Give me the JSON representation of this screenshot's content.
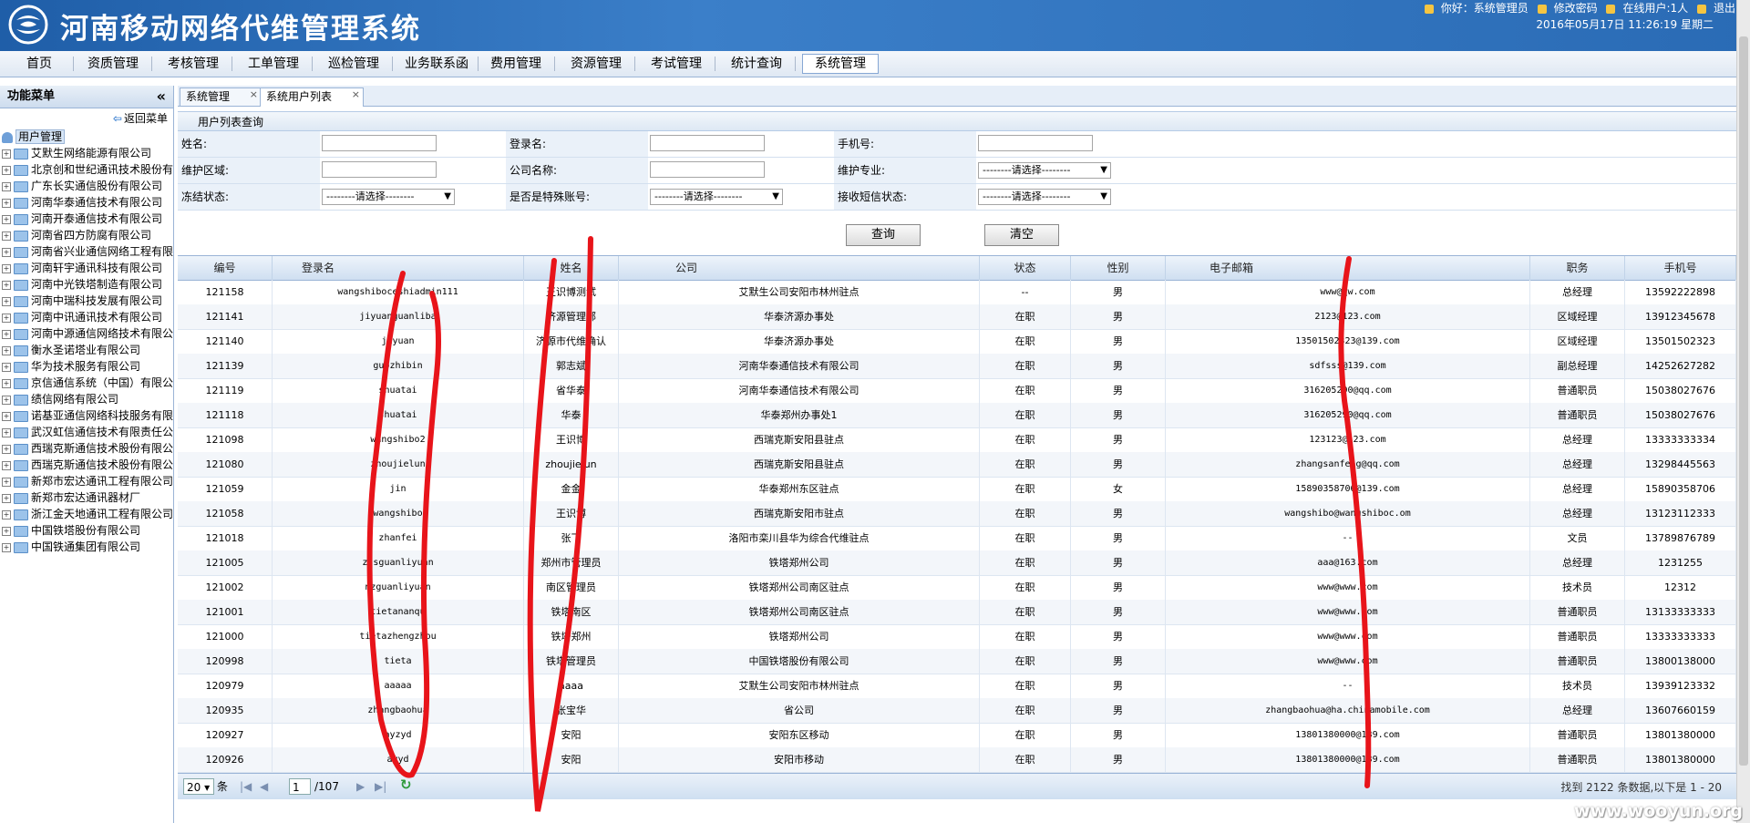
{
  "header": {
    "app_title": "河南移动网络代维管理系统",
    "user_text": "你好：系统管理员",
    "change_pwd": "修改密码",
    "online_users": "在线用户:1人",
    "logout": "退出",
    "datetime": "2016年05月17日  11:26:19 星期二"
  },
  "nav": {
    "items": [
      {
        "label": "首页"
      },
      {
        "label": "资质管理"
      },
      {
        "label": "考核管理"
      },
      {
        "label": "工单管理"
      },
      {
        "label": "巡检管理"
      },
      {
        "label": "业务联系函"
      },
      {
        "label": "费用管理"
      },
      {
        "label": "资源管理"
      },
      {
        "label": "考试管理"
      },
      {
        "label": "统计查询"
      },
      {
        "label": "系统管理"
      }
    ],
    "active_index": 10
  },
  "sidebar": {
    "title": "功能菜单",
    "collapse": "«",
    "back_label": "返回菜单",
    "root_label": "用户管理",
    "nodes": [
      "艾默生网络能源有限公司",
      "北京创和世纪通讯技术股份有限公司",
      "广东长实通信股份有限公司",
      "河南华泰通信技术有限公司",
      "河南开泰通信技术有限公司",
      "河南省四方防腐有限公司",
      "河南省兴业通信网络工程有限公司",
      "河南轩宇通讯科技有限公司",
      "河南中光铁塔制造有限公司",
      "河南中瑞科技发展有限公司",
      "河南中讯通讯技术有限公司",
      "河南中源通信网络技术有限公司",
      "衡水圣诺塔业有限公司",
      "华为技术服务有限公司",
      "京信通信系统（中国）有限公司",
      "绩信网络有限公司",
      "诺基亚通信网络科技服务有限公司",
      "武汉虹信通信技术有限责任公司",
      "西瑞克斯通信技术股份有限公司",
      "西瑞克斯通信技术股份有限公司",
      "新郑市宏达通讯工程有限公司",
      "新郑市宏达通讯器材厂",
      "浙江金天地通讯工程有限公司",
      "中国铁塔股份有限公司",
      "中国铁通集团有限公司"
    ]
  },
  "tabs": [
    {
      "label": "系统管理",
      "close": "×"
    },
    {
      "label": "系统用户列表",
      "close": "×"
    }
  ],
  "panel_title": "用户列表查询",
  "form": {
    "name_label": "姓名:",
    "login_label": "登录名:",
    "phone_label": "手机号:",
    "area_label": "维护区域:",
    "company_label": "公司名称:",
    "specialty_label": "维护专业:",
    "freeze_label": "冻结状态:",
    "special_label": "是否是特殊账号:",
    "sms_label": "接收短信状态:",
    "select_placeholder": "--------请选择--------",
    "query_button": "查询",
    "clear_button": "清空"
  },
  "table": {
    "columns": [
      "编号",
      "登录名",
      "姓名",
      "公司",
      "状态",
      "性别",
      "电子邮箱",
      "职务",
      "手机号"
    ],
    "rows": [
      [
        "121158",
        "wangshiboceshiadmin111",
        "王识博测试",
        "艾默生公司安阳市林州驻点",
        "--",
        "男",
        "www@qw.com",
        "总经理",
        "13592222898"
      ],
      [
        "121141",
        "jiyuanguanliba",
        "济源管理部",
        "华泰济源办事处",
        "在职",
        "男",
        "2123@123.com",
        "区域经理",
        "13912345678"
      ],
      [
        "121140",
        "jiyuan",
        "济源市代维确认",
        "华泰济源办事处",
        "在职",
        "男",
        "13501502323@139.com",
        "区域经理",
        "13501502323"
      ],
      [
        "121139",
        "guozhibin",
        "郭志斌",
        "河南华泰通信技术有限公司",
        "在职",
        "男",
        "sdfsss@139.com",
        "副总经理",
        "14252627282"
      ],
      [
        "121119",
        "shuatai",
        "省华泰",
        "河南华泰通信技术有限公司",
        "在职",
        "男",
        "316205290@qq.com",
        "普通职员",
        "15038027676"
      ],
      [
        "121118",
        "shuatai",
        "华泰",
        "华泰郑州办事处1",
        "在职",
        "男",
        "316205290@qq.com",
        "普通职员",
        "15038027676"
      ],
      [
        "121098",
        "wangshibo2",
        "王识博",
        "西瑞克斯安阳县驻点",
        "在职",
        "男",
        "123123@123.com",
        "总经理",
        "13333333334"
      ],
      [
        "121080",
        "zhoujielun",
        "zhoujielun",
        "西瑞克斯安阳县驻点",
        "在职",
        "男",
        "zhangsanfeng@qq.com",
        "总经理",
        "13298445563"
      ],
      [
        "121059",
        "jin",
        "金金",
        "华泰郑州东区驻点",
        "在职",
        "女",
        "15890358706@139.com",
        "总经理",
        "15890358706"
      ],
      [
        "121058",
        "wangshibo",
        "王识博",
        "西瑞克斯安阳市驻点",
        "在职",
        "男",
        "wangshibo@wangshiboc.om",
        "总经理",
        "13123112333"
      ],
      [
        "121018",
        "zhanfei",
        "张飞",
        "洛阳市栾川县华为综合代维驻点",
        "在职",
        "男",
        "--",
        "文员",
        "13789876789"
      ],
      [
        "121005",
        "zzsguanliyuan",
        "郑州市管理员",
        "铁塔郑州公司",
        "在职",
        "男",
        "aaa@163.com",
        "总经理",
        "1231255"
      ],
      [
        "121002",
        "nzguanliyuan",
        "南区管理员",
        "铁塔郑州公司南区驻点",
        "在职",
        "男",
        "www@www.com",
        "技术员",
        "12312"
      ],
      [
        "121001",
        "tietananqu",
        "铁塔南区",
        "铁塔郑州公司南区驻点",
        "在职",
        "男",
        "www@www.com",
        "普通职员",
        "13133333333"
      ],
      [
        "121000",
        "tietazhengzhou",
        "铁塔郑州",
        "铁塔郑州公司",
        "在职",
        "男",
        "www@www.com",
        "普通职员",
        "13333333333"
      ],
      [
        "120998",
        "tieta",
        "铁塔管理员",
        "中国铁塔股份有限公司",
        "在职",
        "男",
        "www@www.com",
        "普通职员",
        "13800138000"
      ],
      [
        "120979",
        "aaaaa",
        "aaaa",
        "艾默生公司安阳市林州驻点",
        "在职",
        "男",
        "--",
        "技术员",
        "13939123332"
      ],
      [
        "120935",
        "zhangbaohua",
        "张宝华",
        "省公司",
        "在职",
        "男",
        "zhangbaohua@ha.chinamobile.com",
        "总经理",
        "13607660159"
      ],
      [
        "120927",
        "ayzyd",
        "安阳",
        "安阳东区移动",
        "在职",
        "男",
        "13801380000@139.com",
        "普通职员",
        "13801380000"
      ],
      [
        "120926",
        "ayyd",
        "安阳",
        "安阳市移动",
        "在职",
        "男",
        "13801380000@139.com",
        "普通职员",
        "13801380000"
      ]
    ]
  },
  "pager": {
    "page_size": "20",
    "unit": "条",
    "current_page": "1",
    "total_pages": "/107",
    "info": "找到 2122 条数据,以下是 1 - 20"
  },
  "watermark": "www.wooyun.org",
  "colors": {
    "header_blue": "#2a6bb5",
    "annotation_red": "#e8141a"
  }
}
